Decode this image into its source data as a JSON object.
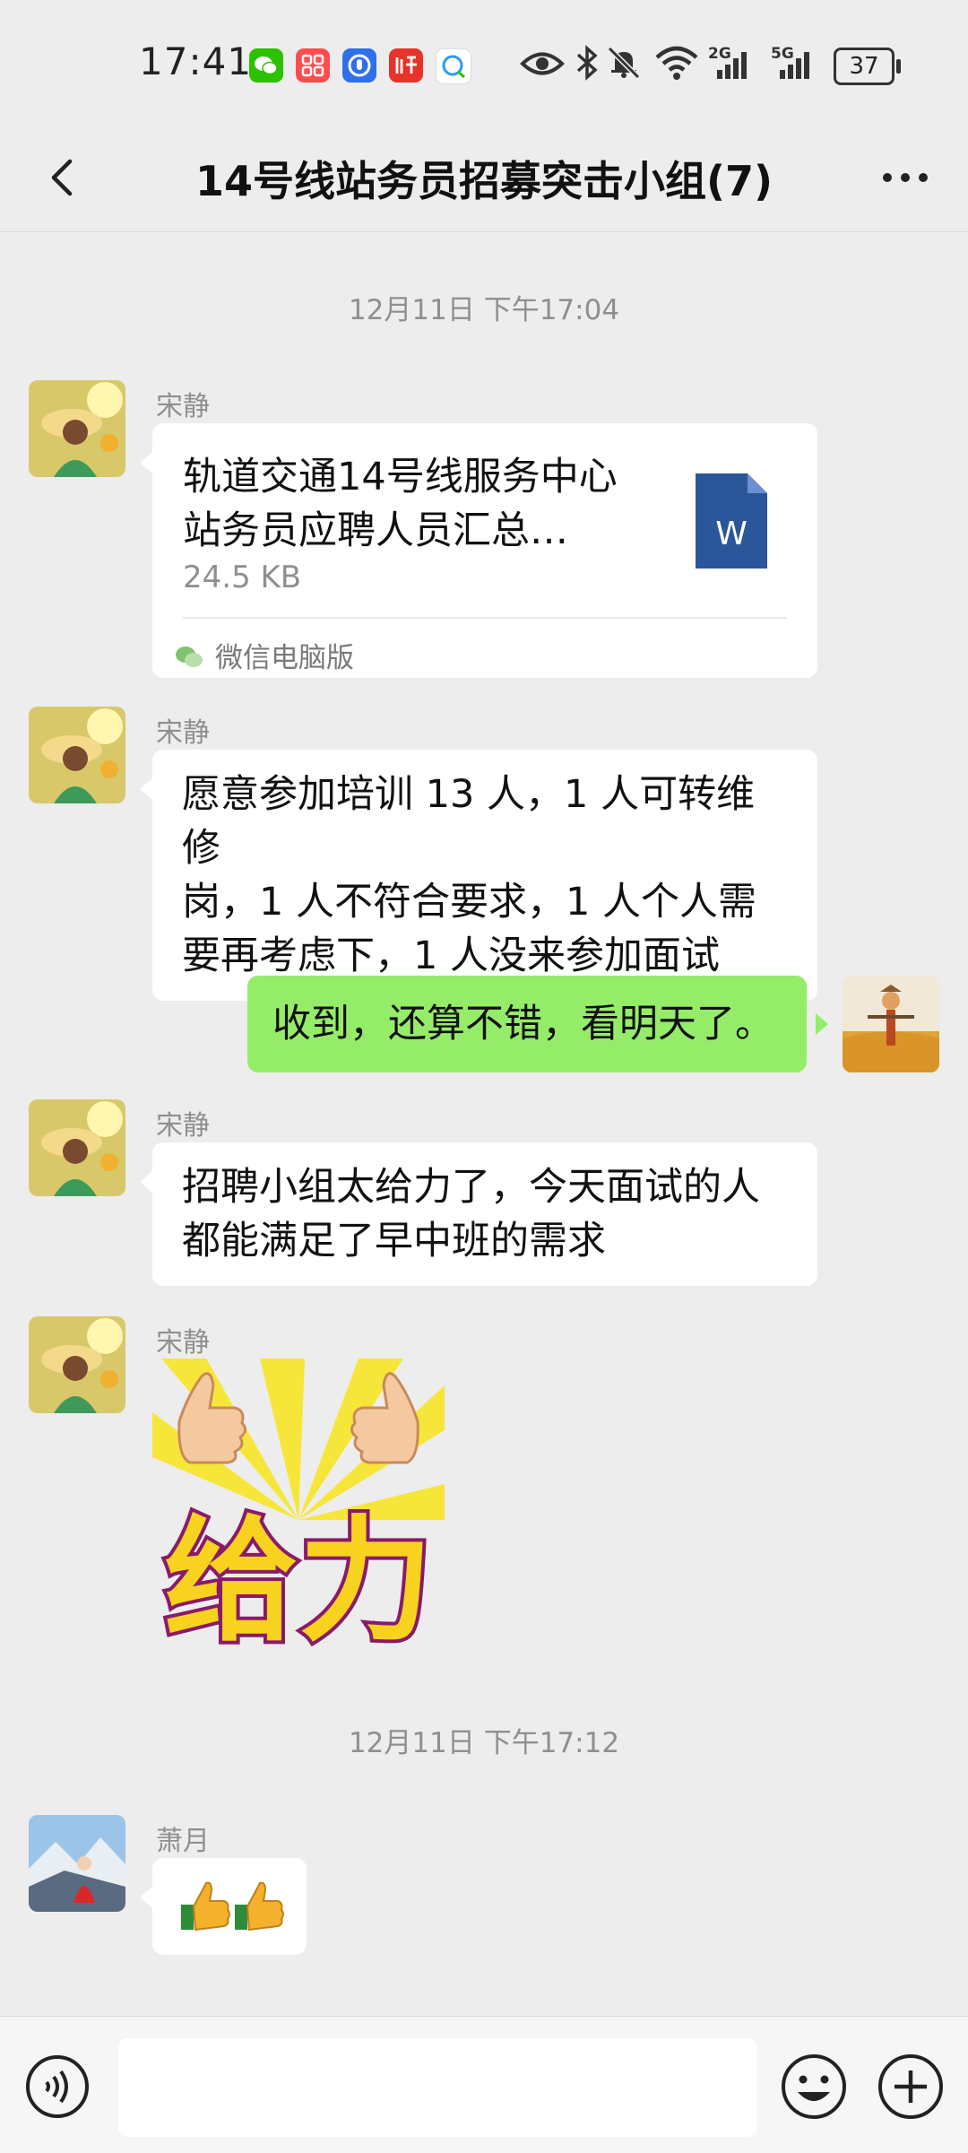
{
  "status_bar": {
    "time": "17:41",
    "net1": "2G",
    "net2": "5G",
    "battery": "37",
    "icons": [
      "wechat-icon",
      "app-grid-icon",
      "shield-app-icon",
      "listen-app-icon",
      "chat-app-icon",
      "eye-icon",
      "bluetooth-icon",
      "mute-bell-icon",
      "wifi-icon",
      "signal-icon",
      "signal-icon",
      "battery-icon"
    ]
  },
  "header": {
    "title": "14号线站务员招募突击小组(7)",
    "back_icon": "chevron-left-icon",
    "more_icon": "more-dots-icon"
  },
  "chat": {
    "timestamp1": "12月11日 下午17:04",
    "timestamp2": "12月11日 下午17:12",
    "messages": [
      {
        "sender": "宋静",
        "type": "file",
        "file_name_line1": "轨道交通14号线服务中心",
        "file_name_line2": "站务员应聘人员汇总…",
        "file_size": "24.5 KB",
        "file_icon_letter": "W",
        "source": "微信电脑版"
      },
      {
        "sender": "宋静",
        "type": "text",
        "lines": [
          "愿意参加培训 13 人，1 人可转维修",
          "岗，1 人不符合要求，1 人个人需",
          "要再考虑下，1 人没来参加面试"
        ]
      },
      {
        "sender": "self",
        "type": "text",
        "text": "收到，还算不错，看明天了。"
      },
      {
        "sender": "宋静",
        "type": "text",
        "lines": [
          "招聘小组太给力了，今天面试的人",
          "都能满足了早中班的需求"
        ]
      },
      {
        "sender": "宋静",
        "type": "sticker",
        "sticker_text": "给力"
      },
      {
        "sender": "萧月",
        "type": "emoji",
        "text": "👍👍"
      }
    ]
  },
  "input_bar": {
    "placeholder": "",
    "icons": [
      "voice-icon",
      "emoji-icon",
      "plus-icon"
    ]
  },
  "colors": {
    "background": "#ededed",
    "bubble_self": "#95ec69",
    "bubble_other": "#ffffff",
    "word_blue": "#2b579a"
  }
}
